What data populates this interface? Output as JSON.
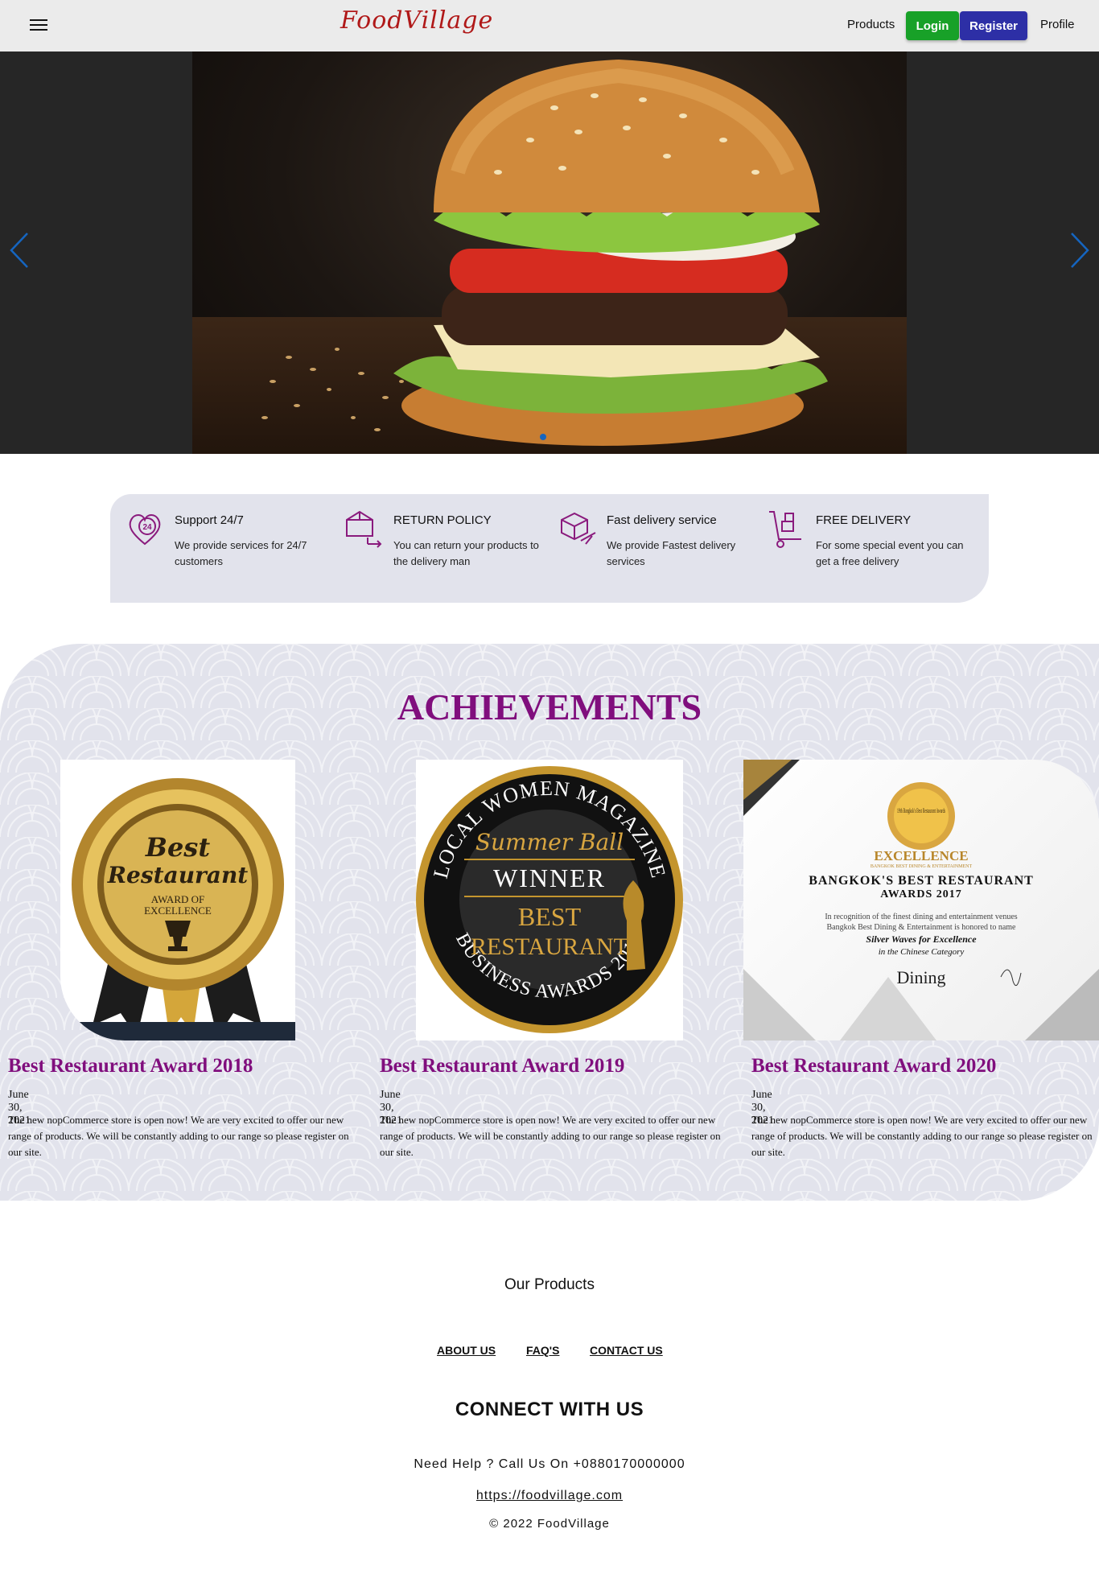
{
  "header": {
    "brand": "FoodVillage",
    "nav": {
      "products": "Products",
      "login": "Login",
      "register": "Register",
      "profile": "Profile"
    }
  },
  "carousel": {
    "active_slide": 1,
    "slide_count": 1
  },
  "features": [
    {
      "icon": "support-24-icon",
      "title": "Support 24/7",
      "text": "We provide services for 24/7 customers"
    },
    {
      "icon": "return-box-icon",
      "title": "RETURN POLICY",
      "text": "You can return your products to the delivery man"
    },
    {
      "icon": "fast-delivery-icon",
      "title": "Fast delivery service",
      "text": "We provide Fastest delivery services"
    },
    {
      "icon": "hand-truck-icon",
      "title": "FREE DELIVERY",
      "text": "For some special event you can get a free delivery"
    }
  ],
  "achievements": {
    "heading": "ACHIEVEMENTS",
    "items": [
      {
        "title": "Best Restaurant Award 2018",
        "date": "June 30, 2021",
        "text": "The new nopCommerce store is open now! We are very excited to offer our new range of products. We will be constantly adding to our range so please register on our site.",
        "badge": {
          "line1": "Best",
          "line2": "Restaurant",
          "line3": "AWARD OF",
          "line4": "EXCELLENCE"
        }
      },
      {
        "title": "Best Restaurant Award 2019",
        "date": "June 30, 2021",
        "text": "The new nopCommerce store is open now! We are very excited to offer our new range of products. We will be constantly adding to our range so please register on our site.",
        "badge": {
          "top": "LOCAL WOMEN MAGAZINE",
          "script": "Summer Ball",
          "winner": "WINNER",
          "best": "BEST",
          "restaurant": "RESTAURANT",
          "bottom": "BUSINESS AWARDS 2016"
        }
      },
      {
        "title": "Best Restaurant Award 2020",
        "date": "June 30, 2021",
        "text": "The new nopCommerce store is open now! We are very excited to offer our new range of products. We will be constantly adding to our range so please register on our site.",
        "certificate": {
          "seal": "19th Bangkok's Best Restaurant Awards",
          "excellence": "EXCELLENCE",
          "sub": "BANGKOK BEST DINING & ENTERTAINMENT",
          "title1": "BANGKOK'S BEST RESTAURANT",
          "title2": "AWARDS 2017",
          "line1": "In recognition of the finest dining and entertainment venues",
          "line2": "Bangkok Best Dining & Entertainment is honored to name",
          "line3": "Silver Waves for Excellence",
          "line4": "in the Chinese Category",
          "brand": "Dining"
        }
      }
    ]
  },
  "footer": {
    "our_products": "Our Products",
    "links": {
      "about": "ABOUT US",
      "faq": "FAQ'S",
      "contact": "CONTACT US"
    },
    "connect": "CONNECT WITH US",
    "help": "Need Help ? Call Us On +0880170000000",
    "website": "https://foodvillage.com",
    "copyright": "© 2022 FoodVillage"
  },
  "colors": {
    "brand": "#b01818",
    "login": "#18a128",
    "register": "#2d2fa6",
    "accent_purple": "#800e7d",
    "section_bg": "#e2e3ec"
  }
}
